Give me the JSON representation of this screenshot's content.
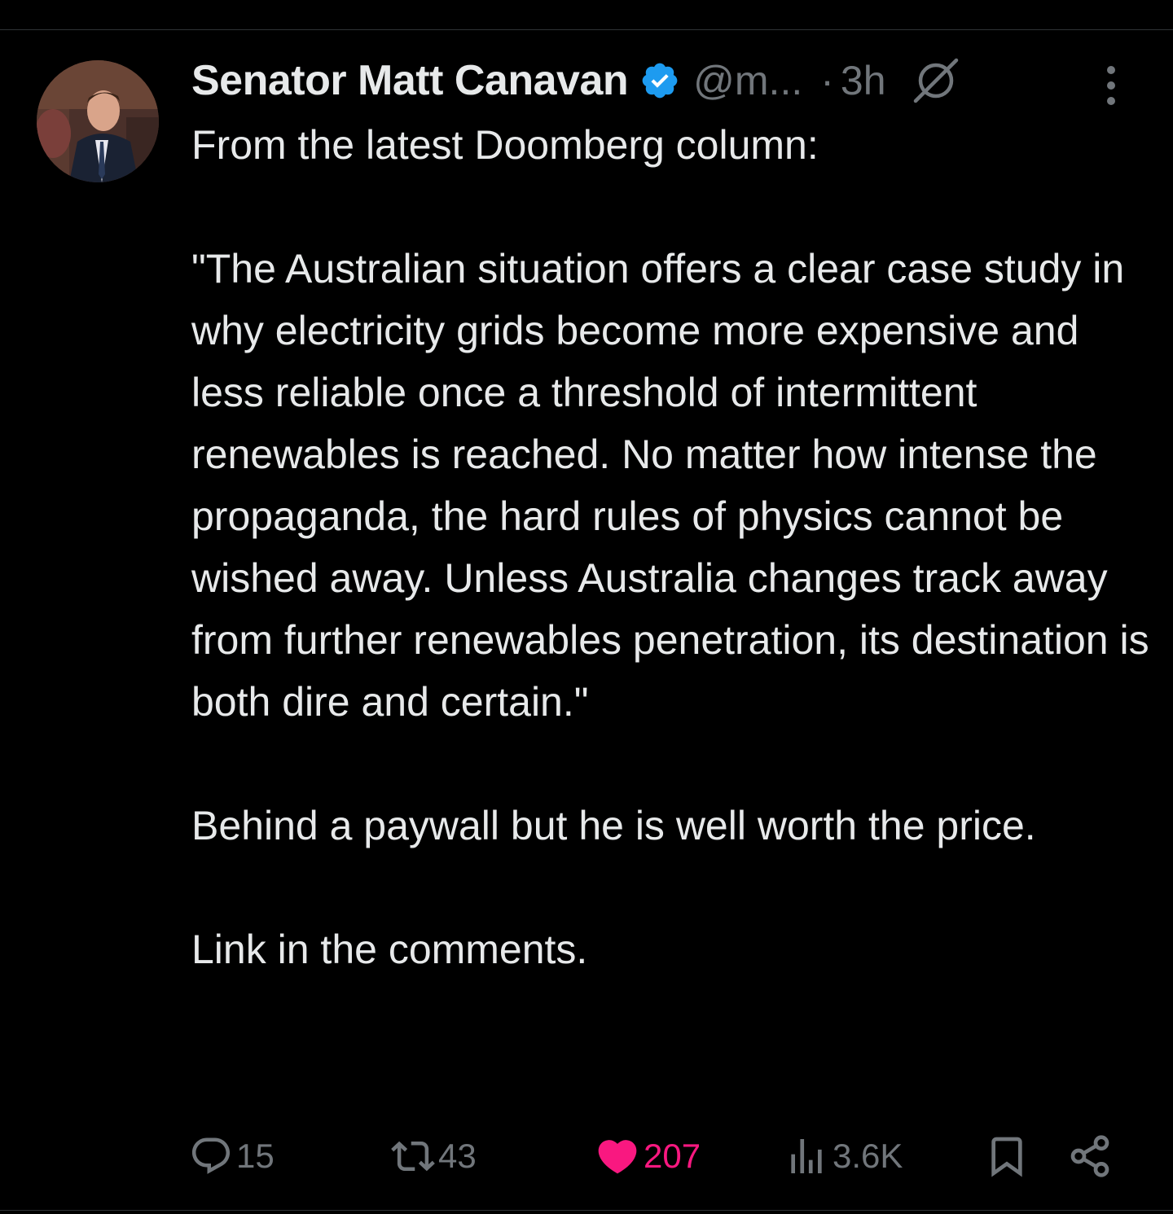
{
  "post": {
    "author_name": "Senator Matt Canavan",
    "handle": "@m...",
    "separator": "·",
    "time": "3h",
    "body": [
      "From the latest Doomberg column:",
      "\"The Australian situation offers a clear case study in why electricity grids become more expensive and less reliable once a threshold of intermittent renewables is reached. No matter how intense the propaganda, the hard rules of physics cannot be wished away. Unless Australia changes track away from further renewables penetration, its destination is both dire and certain.\"",
      "Behind a paywall but he is well worth the price.",
      "Link in the comments."
    ]
  },
  "actions": {
    "replies": "15",
    "reposts": "43",
    "likes": "207",
    "views": "3.6K"
  },
  "icons": {
    "verified": "verified-badge-icon",
    "grok": "grok-icon",
    "more": "more-vertical-icon",
    "reply": "reply-icon",
    "repost": "repost-icon",
    "like": "heart-icon",
    "views": "views-icon",
    "bookmark": "bookmark-icon",
    "share": "share-icon"
  },
  "colors": {
    "background": "#000000",
    "text": "#e7e9ea",
    "muted": "#71767b",
    "verified": "#1d9bf0",
    "like": "#f91880"
  }
}
